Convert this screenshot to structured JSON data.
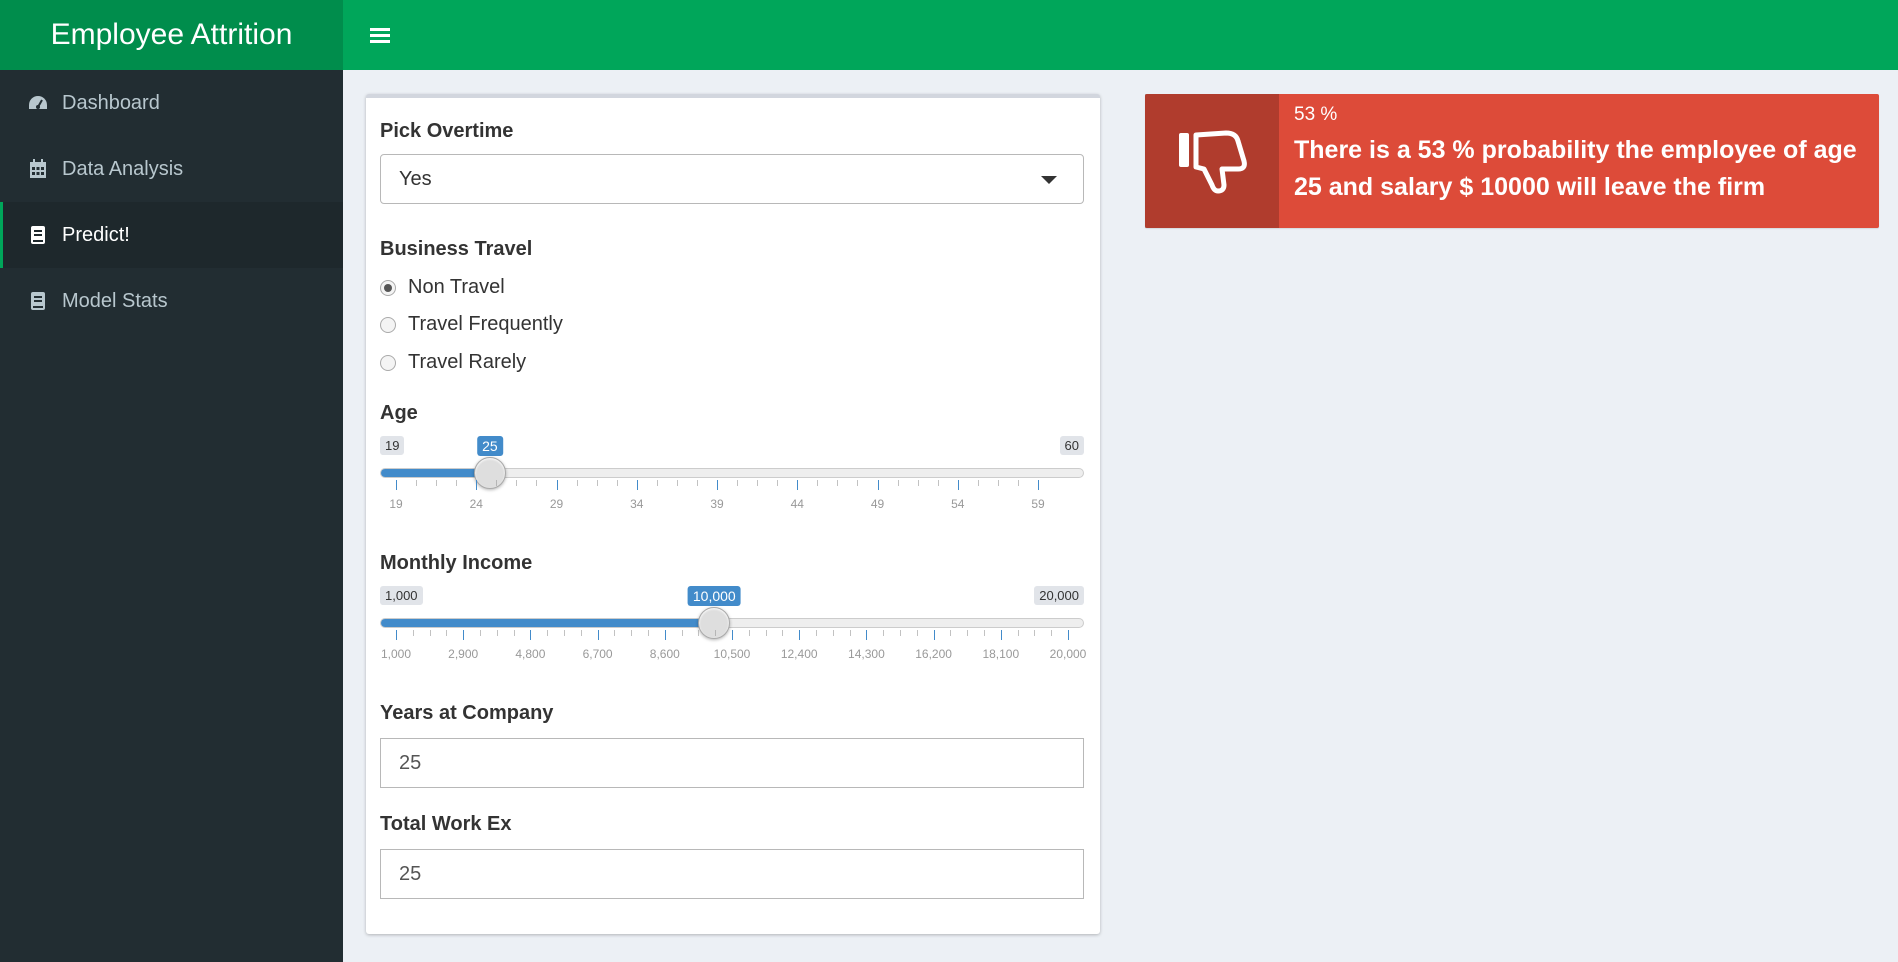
{
  "app": {
    "title": "Employee Attrition"
  },
  "sidebar": {
    "items": [
      {
        "label": "Dashboard",
        "icon": "dashboard-icon"
      },
      {
        "label": "Data Analysis",
        "icon": "calendar-icon"
      },
      {
        "label": "Predict!",
        "icon": "book-icon",
        "active": true
      },
      {
        "label": "Model Stats",
        "icon": "book-icon"
      }
    ]
  },
  "form": {
    "overtime": {
      "label": "Pick Overtime",
      "value": "Yes"
    },
    "travel": {
      "label": "Business Travel",
      "options": [
        "Non Travel",
        "Travel Frequently",
        "Travel Rarely"
      ],
      "selected": "Non Travel"
    },
    "age": {
      "label": "Age",
      "min_label": "19",
      "max_label": "60",
      "value_label": "25",
      "min": 19,
      "max": 60,
      "value": 25,
      "ticks": [
        "19",
        "24",
        "29",
        "34",
        "39",
        "44",
        "49",
        "54",
        "59"
      ]
    },
    "income": {
      "label": "Monthly Income",
      "min_label": "1,000",
      "max_label": "20,000",
      "value_label": "10,000",
      "min": 1000,
      "max": 20000,
      "value": 10000,
      "ticks": [
        "1,000",
        "2,900",
        "4,800",
        "6,700",
        "8,600",
        "10,500",
        "12,400",
        "14,300",
        "16,200",
        "18,100",
        "20,000"
      ]
    },
    "years": {
      "label": "Years at Company",
      "value": "25"
    },
    "workex": {
      "label": "Total Work Ex",
      "value": "25"
    }
  },
  "prediction": {
    "value": "53 %",
    "text": "There is a 53 % probability the employee of age 25 and salary $ 10000 will leave the firm",
    "color": "#dd4b39",
    "icon": "thumbs-down-icon"
  }
}
